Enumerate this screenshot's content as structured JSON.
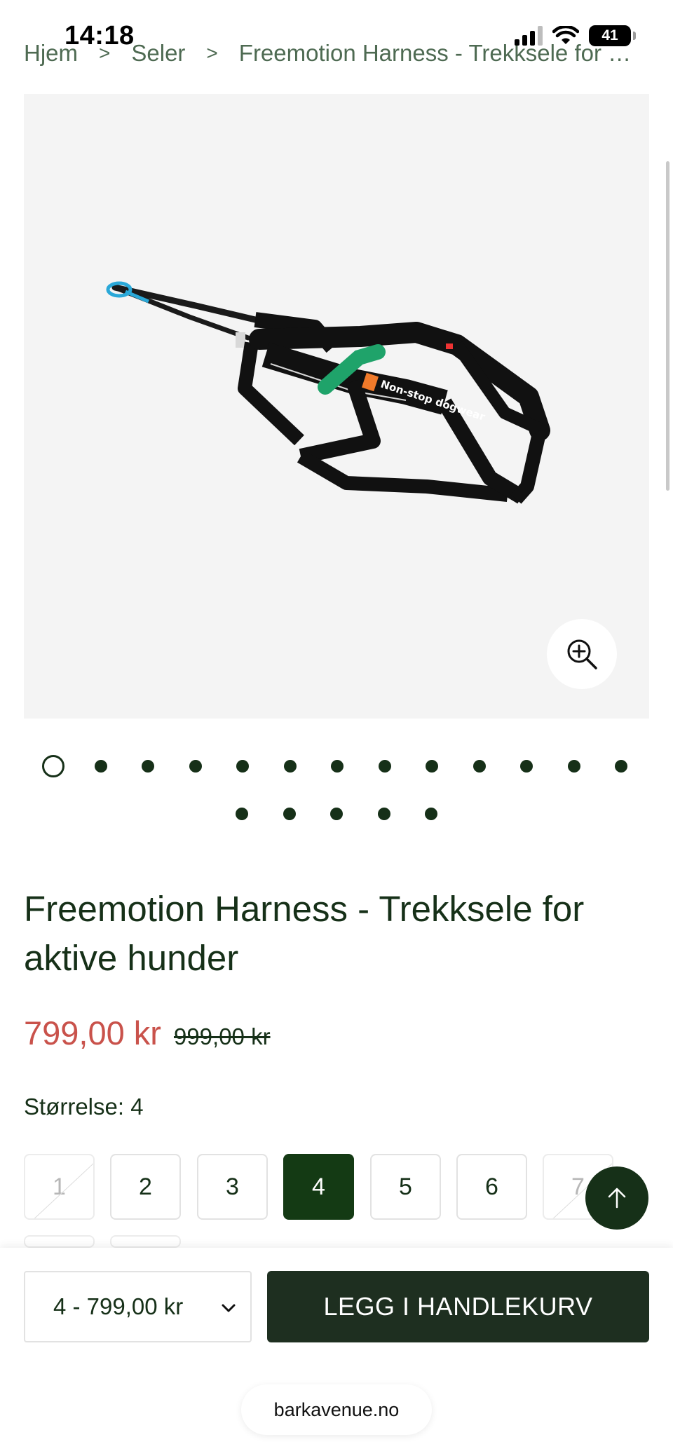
{
  "status_bar": {
    "time": "14:18",
    "battery": "41"
  },
  "breadcrumb": {
    "items": [
      "Hjem",
      "Seler",
      "Freemotion Harness - Trekksele for akt..."
    ],
    "separator": ">"
  },
  "gallery": {
    "image_alt": "Non-stop dogwear Freemotion harness",
    "brand_print": "Non-stop dogwear",
    "slides_total": 18,
    "active_slide": 1
  },
  "product": {
    "title": "Freemotion Harness - Trekksele for aktive hunder",
    "sale_price": "799,00 kr",
    "original_price": "999,00 kr"
  },
  "size": {
    "label": "Størrelse: 4",
    "options": [
      {
        "label": "1",
        "state": "disabled"
      },
      {
        "label": "2",
        "state": "available"
      },
      {
        "label": "3",
        "state": "available"
      },
      {
        "label": "4",
        "state": "selected"
      },
      {
        "label": "5",
        "state": "available"
      },
      {
        "label": "6",
        "state": "available"
      },
      {
        "label": "7",
        "state": "disabled"
      }
    ]
  },
  "purchase_bar": {
    "variant_value": "4 - 799,00 kr",
    "add_to_cart_label": "LEGG I HANDLEKURV"
  },
  "browser": {
    "url": "barkavenue.no"
  },
  "colors": {
    "primary_green": "#163018",
    "sale_red": "#c9524b",
    "button_dark": "#1e2f20"
  }
}
